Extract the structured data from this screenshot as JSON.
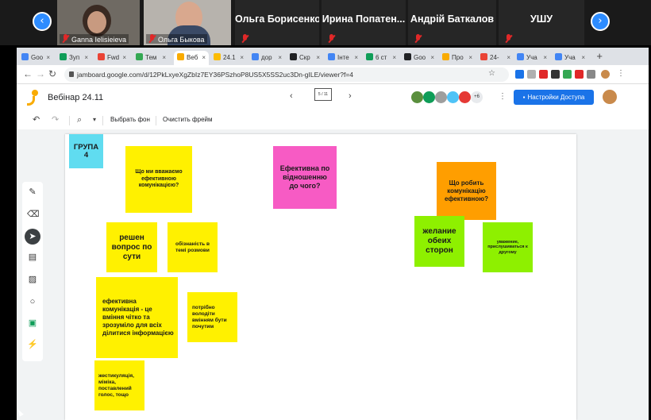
{
  "zoom": {
    "participants": [
      {
        "name": "Ganna Ielisieieva",
        "video": true
      },
      {
        "name": "Ольга Быкова",
        "video": true
      },
      {
        "name": "Ольга Борисенко",
        "video": false
      },
      {
        "name": "Ирина  Попатен...",
        "video": false
      },
      {
        "name": "Андрій Баткалов",
        "video": false
      },
      {
        "name": "УШУ",
        "video": false
      }
    ],
    "prev_icon": "‹",
    "next_icon": "›"
  },
  "browser": {
    "tabs": [
      {
        "label": "Goo",
        "color": "#4285f4"
      },
      {
        "label": "Зуп",
        "color": "#0f9d58"
      },
      {
        "label": "Fwd",
        "color": "#ea4335"
      },
      {
        "label": "Тем",
        "color": "#34a853"
      },
      {
        "label": "Веб",
        "color": "#f9ab00",
        "active": true
      },
      {
        "label": "24.1",
        "color": "#fbbc04"
      },
      {
        "label": "дор",
        "color": "#4285f4"
      },
      {
        "label": "Скр",
        "color": "#202124"
      },
      {
        "label": "Інте",
        "color": "#4285f4"
      },
      {
        "label": "6 ст",
        "color": "#0f9d58"
      },
      {
        "label": "Goo",
        "color": "#202124"
      },
      {
        "label": "Про",
        "color": "#f9ab00"
      },
      {
        "label": "24-",
        "color": "#ea4335"
      },
      {
        "label": "Уча",
        "color": "#4285f4"
      },
      {
        "label": "Уча",
        "color": "#4285f4"
      }
    ],
    "url": "jamboard.google.com/d/12PkLxyeXgZbIz7EY36PSzhoP8US5X5SS2uc3Dn-gILE/viewer?f=4"
  },
  "jamboard": {
    "title": "Вебінар 24.11",
    "frame_label": "5 / 11",
    "share_label": "Настройки Доступа",
    "more_count": "+6",
    "toolbar": {
      "set_background": "Выбрать фон",
      "clear_frame": "Очистить фрейм"
    },
    "notes": [
      {
        "text": "ГРУПА 4",
        "color": "cyan"
      },
      {
        "text": "Що ми вважаємо ефективною комунікацією?",
        "color": "yellow"
      },
      {
        "text": "Ефективна по відношенню до чого?",
        "color": "pink"
      },
      {
        "text": "Що робить комунікацію ефективною?",
        "color": "orange"
      },
      {
        "text": "решен вопрос по сути",
        "color": "yellow"
      },
      {
        "text": "обізнаність в темі розмови",
        "color": "yellow"
      },
      {
        "text": "желание обеих сторон",
        "color": "green"
      },
      {
        "text": "уважение, прислушиваться к другому",
        "color": "green"
      },
      {
        "text": "ефективна комунікація - це вміння чітко та зрозуміло для всіх ділитися інформацією",
        "color": "yellow"
      },
      {
        "text": "потрібно володіти вмінням бути почутим",
        "color": "yellow"
      },
      {
        "text": "жестикуляція, міміка, поставлений голос, тощо",
        "color": "yellow"
      }
    ]
  }
}
